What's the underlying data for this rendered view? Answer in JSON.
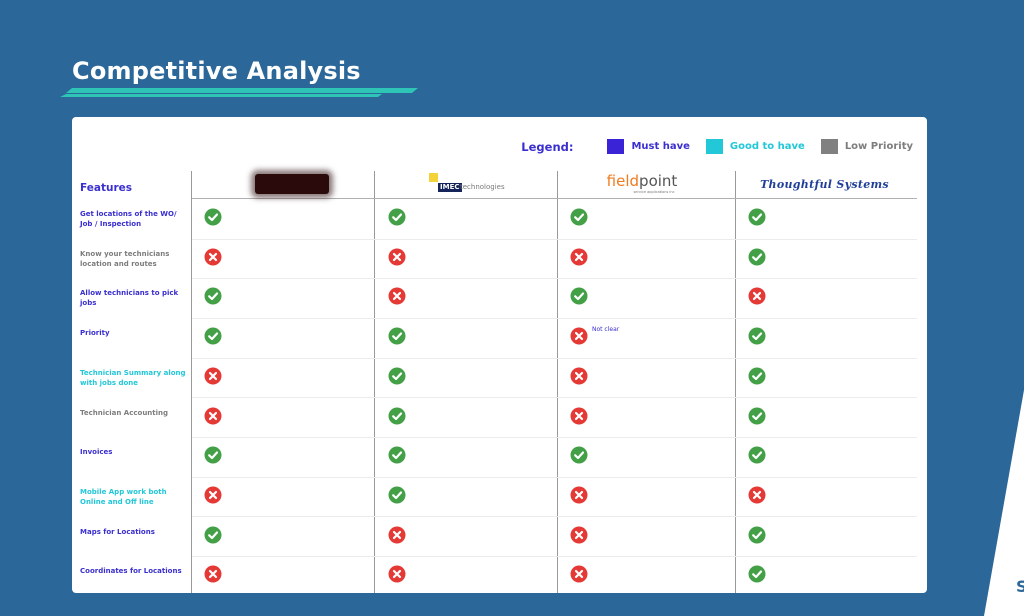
{
  "page": {
    "title": "Competitive Analysis"
  },
  "legend": {
    "title": "Legend:",
    "items": [
      {
        "label": "Must have",
        "color": "#3a22d6",
        "text_color": "#3a2fcf"
      },
      {
        "label": "Good to have",
        "color": "#22c7d8",
        "text_color": "#22c7d8"
      },
      {
        "label": "Low Priority",
        "color": "#808080",
        "text_color": "#7d7d7d"
      }
    ]
  },
  "table": {
    "features_header": "Features",
    "competitors": [
      {
        "name": "redacted-logo",
        "text": ""
      },
      {
        "name": "imec-technologies",
        "badge": "IMEC",
        "text": "technologies"
      },
      {
        "name": "fieldpoint",
        "text_a": "field",
        "text_b": "point",
        "sub": "service applications inc"
      },
      {
        "name": "thoughtful-systems",
        "text": "Thoughtful Systems"
      }
    ],
    "rows": [
      {
        "feature": "Get locations of the WO/ Job / Inspection",
        "priority": "must",
        "values": [
          "yes",
          "yes",
          "yes",
          "yes"
        ]
      },
      {
        "feature": "Know your technicians location and routes",
        "priority": "low",
        "values": [
          "no",
          "no",
          "no",
          "yes"
        ]
      },
      {
        "feature": "Allow technicians to pick jobs",
        "priority": "must",
        "values": [
          "yes",
          "no",
          "yes",
          "no"
        ]
      },
      {
        "feature": "Priority",
        "priority": "must",
        "values": [
          "yes",
          "yes",
          "no",
          "yes"
        ],
        "note": "Not clear"
      },
      {
        "feature": "Technician Summary along with jobs done",
        "priority": "good",
        "values": [
          "no",
          "yes",
          "no",
          "yes"
        ]
      },
      {
        "feature": "Technician Accounting",
        "priority": "low",
        "values": [
          "no",
          "yes",
          "no",
          "yes"
        ]
      },
      {
        "feature": "Invoices",
        "priority": "must",
        "values": [
          "yes",
          "yes",
          "yes",
          "yes"
        ]
      },
      {
        "feature": "Mobile App work both Online and Off line",
        "priority": "good",
        "values": [
          "no",
          "yes",
          "no",
          "no"
        ]
      },
      {
        "feature": "Maps for Locations",
        "priority": "must",
        "values": [
          "yes",
          "no",
          "no",
          "yes"
        ]
      },
      {
        "feature": "Coordinates for Locations",
        "priority": "must",
        "values": [
          "no",
          "no",
          "no",
          "yes"
        ]
      }
    ]
  },
  "colors": {
    "background": "#2b6798",
    "accent": "#2ec4b6",
    "check": "#43a047",
    "cross": "#e53935",
    "must": "#3a2fcf",
    "good": "#22c7d8",
    "low": "#7d7d7d"
  }
}
